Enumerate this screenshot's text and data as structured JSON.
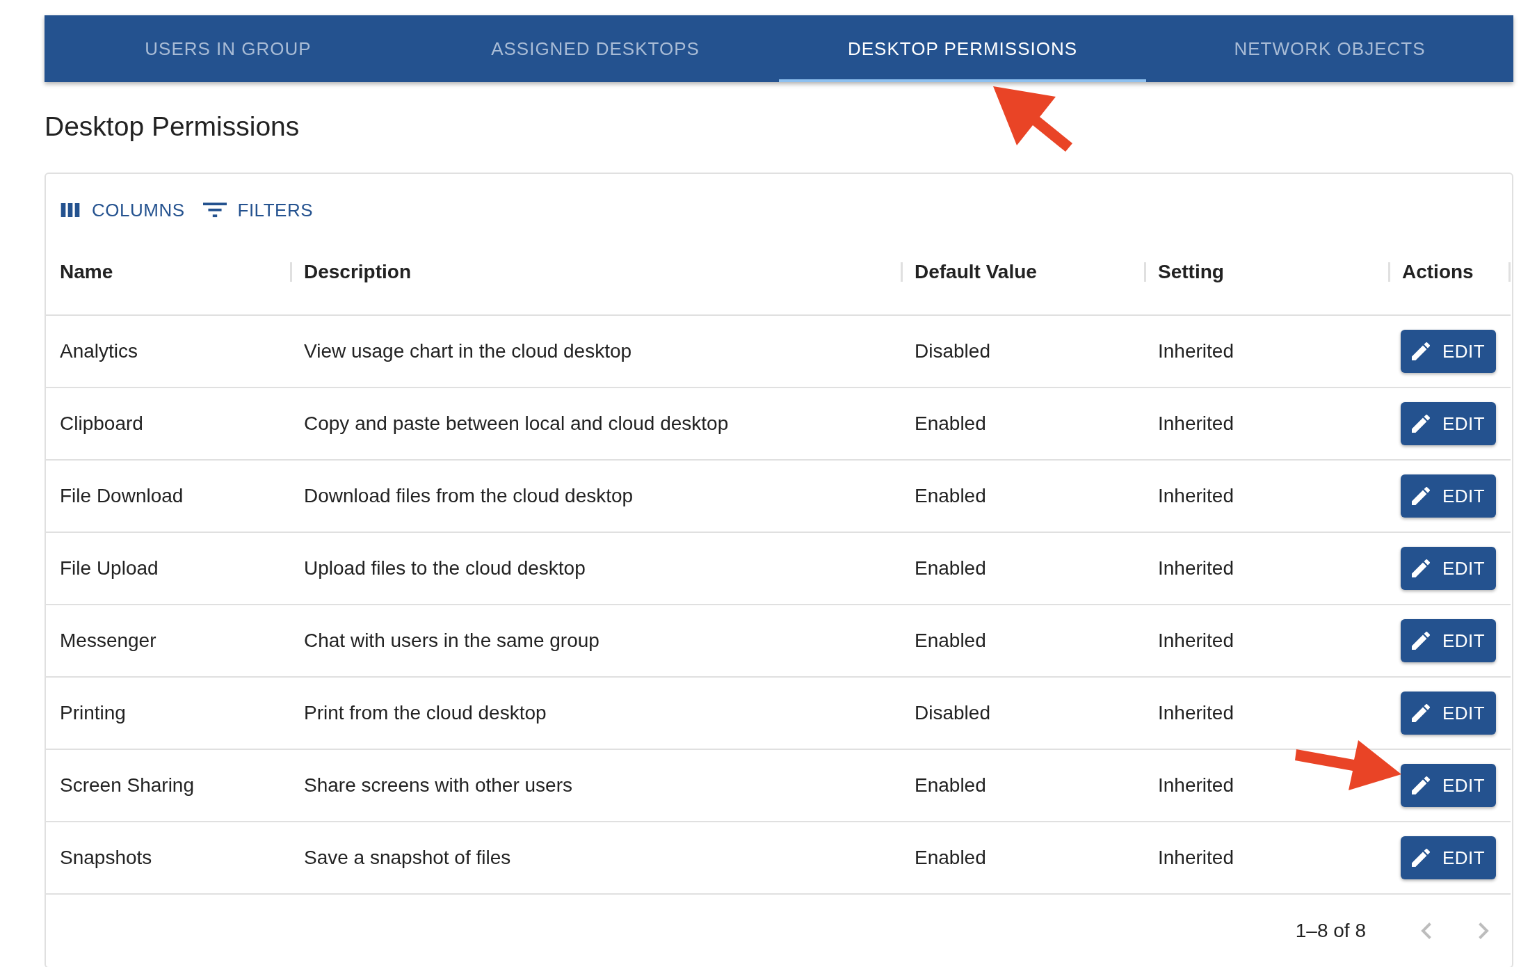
{
  "tabs": [
    {
      "label": "USERS IN GROUP",
      "selected": false
    },
    {
      "label": "ASSIGNED DESKTOPS",
      "selected": false
    },
    {
      "label": "DESKTOP PERMISSIONS",
      "selected": true
    },
    {
      "label": "NETWORK OBJECTS",
      "selected": false
    }
  ],
  "heading": "Desktop Permissions",
  "toolbar": [
    {
      "kind": "columns",
      "label": "COLUMNS"
    },
    {
      "kind": "filters",
      "label": "FILTERS"
    }
  ],
  "table": {
    "columns": [
      "Name",
      "Description",
      "Default Value",
      "Setting",
      "Actions"
    ],
    "rows": [
      {
        "name": "Analytics",
        "description": "View usage chart in the cloud desktop",
        "default_value": "Disabled",
        "setting": "Inherited",
        "action": "EDIT"
      },
      {
        "name": "Clipboard",
        "description": "Copy and paste between local and cloud desktop",
        "default_value": "Enabled",
        "setting": "Inherited",
        "action": "EDIT"
      },
      {
        "name": "File Download",
        "description": "Download files from the cloud desktop",
        "default_value": "Enabled",
        "setting": "Inherited",
        "action": "EDIT"
      },
      {
        "name": "File Upload",
        "description": "Upload files to the cloud desktop",
        "default_value": "Enabled",
        "setting": "Inherited",
        "action": "EDIT"
      },
      {
        "name": "Messenger",
        "description": "Chat with users in the same group",
        "default_value": "Enabled",
        "setting": "Inherited",
        "action": "EDIT"
      },
      {
        "name": "Printing",
        "description": "Print from the cloud desktop",
        "default_value": "Disabled",
        "setting": "Inherited",
        "action": "EDIT"
      },
      {
        "name": "Screen Sharing",
        "description": "Share screens with other users",
        "default_value": "Enabled",
        "setting": "Inherited",
        "action": "EDIT"
      },
      {
        "name": "Snapshots",
        "description": "Save a snapshot of files",
        "default_value": "Enabled",
        "setting": "Inherited",
        "action": "EDIT"
      }
    ]
  },
  "pagination": {
    "range": "1–8 of 8",
    "previous": {
      "disabled": true
    },
    "next": {
      "disabled": true
    }
  }
}
